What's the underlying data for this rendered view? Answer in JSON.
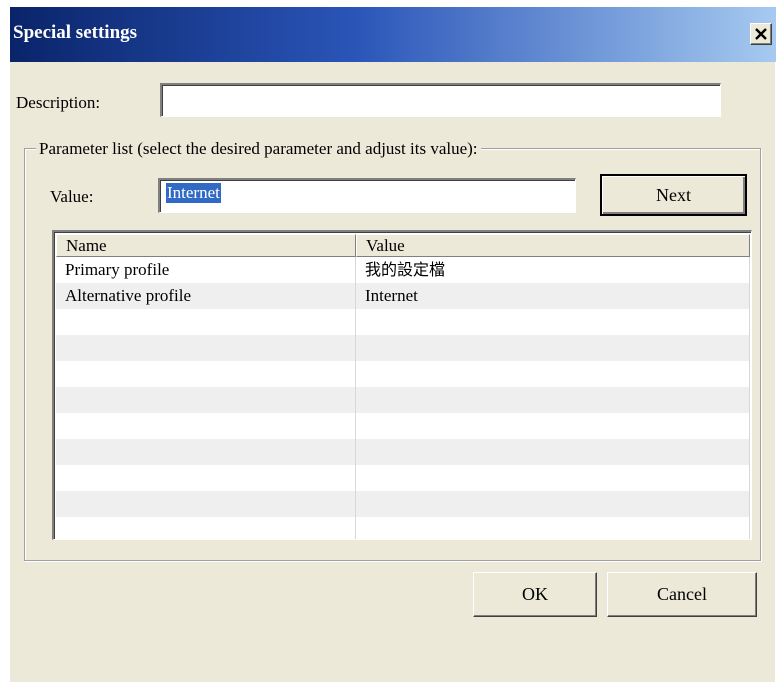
{
  "window": {
    "title": "Special settings",
    "close_icon": "close-icon"
  },
  "description": {
    "label": "Description:",
    "value": ""
  },
  "parameter_group": {
    "legend": "Parameter list (select the desired parameter and adjust its value):",
    "value_label": "Value:",
    "value_input": "Internet",
    "next_label": "Next"
  },
  "table": {
    "columns": [
      "Name",
      "Value"
    ],
    "rows": [
      {
        "name": "Primary profile",
        "value": "我的設定檔"
      },
      {
        "name": "Alternative profile",
        "value": "Internet"
      },
      {
        "name": "",
        "value": ""
      },
      {
        "name": "",
        "value": ""
      },
      {
        "name": "",
        "value": ""
      },
      {
        "name": "",
        "value": ""
      },
      {
        "name": "",
        "value": ""
      },
      {
        "name": "",
        "value": ""
      },
      {
        "name": "",
        "value": ""
      },
      {
        "name": "",
        "value": ""
      },
      {
        "name": "",
        "value": ""
      }
    ]
  },
  "buttons": {
    "ok_label": "OK",
    "cancel_label": "Cancel"
  },
  "colors": {
    "titlebar_start": "#0a246a",
    "titlebar_end": "#a6caf0",
    "dialog_bg": "#ece9d8",
    "selection": "#316ac5"
  }
}
